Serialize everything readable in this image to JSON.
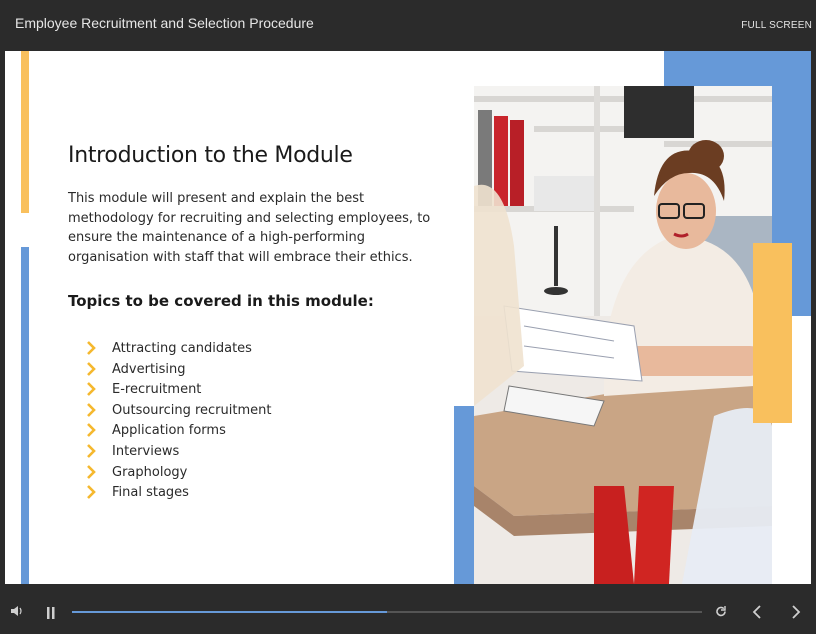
{
  "header": {
    "course_title": "Employee Recruitment and Selection Procedure",
    "fullscreen_label": "FULL SCREEN"
  },
  "slide": {
    "heading": "Introduction to the Module",
    "intro": "This module will present and explain the best methodology for recruiting and selecting employees, to ensure the maintenance of a high-performing organisation with staff that will embrace their ethics.",
    "subheading": "Topics to be covered in this module:",
    "topics": [
      "Attracting candidates",
      "Advertising",
      "E-recruitment",
      "Outsourcing recruitment",
      "Application forms",
      "Interviews",
      "Graphology",
      "Final stages"
    ],
    "bullet_icon": "chevron-right-icon",
    "photo_icon": "interview-photo"
  },
  "player": {
    "volume_icon": "volume-icon",
    "pause_icon": "pause-icon",
    "replay_icon": "replay-icon",
    "prev_icon": "chevron-left-icon",
    "next_icon": "chevron-right-icon",
    "progress": 0.5
  },
  "colors": {
    "accent_yellow": "#f9c05d",
    "accent_blue": "#6699d8",
    "bar_bg": "#2b2b2b",
    "bullet": "#f5b82e"
  }
}
